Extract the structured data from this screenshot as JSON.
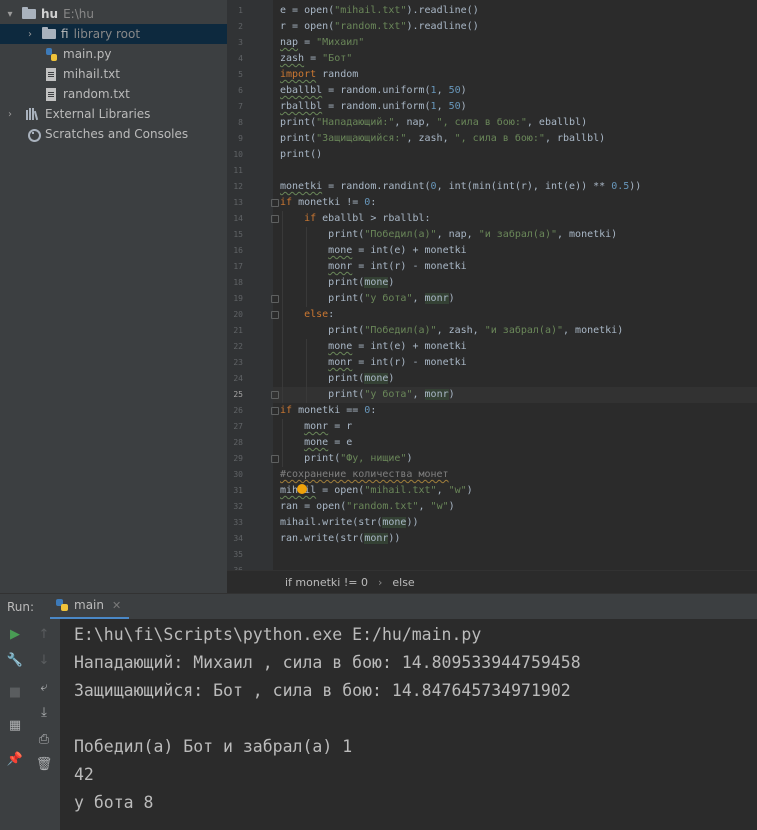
{
  "project_tree": {
    "root": {
      "name": "hu",
      "path": "E:\\hu"
    },
    "venv": {
      "name": "fi",
      "tag": "library root"
    },
    "files": [
      "main.py",
      "mihail.txt",
      "random.txt"
    ],
    "external": "External Libraries",
    "scratches": "Scratches and Consoles"
  },
  "editor": {
    "current_line": 25,
    "lines": [
      "e = open(\"mihail.txt\").readline()",
      "r = open(\"random.txt\").readline()",
      "nap = \"Михаил\"",
      "zash = \"Бот\"",
      "import random",
      "eballbl = random.uniform(1, 50)",
      "rballbl = random.uniform(1, 50)",
      "print(\"Нападающий:\", nap, \", сила в бою:\", eballbl)",
      "print(\"Защищающийся:\", zash, \", сила в бою:\", rballbl)",
      "print()",
      "",
      "monetki = random.randint(0, int(min(int(r), int(e)) ** 0.5))",
      "if monetki != 0:",
      "    if eballbl > rballbl:",
      "        print(\"Победил(а)\", nap, \"и забрал(а)\", monetki)",
      "        mone = int(e) + monetki",
      "        monr = int(r) - monetki",
      "        print(mone)",
      "        print(\"у бота\", monr)",
      "    else:",
      "        print(\"Победил(а)\", zash, \"и забрал(а)\", monetki)",
      "        mone = int(e) + monetki",
      "        monr = int(r) - monetki",
      "        print(mone)",
      "        print(\"у бота\", monr)",
      "if monetki == 0:",
      "    monr = r",
      "    mone = e",
      "    print(\"Фу, нищие\")",
      "#сохранение количества монет",
      "mihail = open(\"mihail.txt\", \"w\")",
      "ran = open(\"random.txt\", \"w\")",
      "mihail.write(str(mone))",
      "ran.write(str(monr))",
      "",
      ""
    ]
  },
  "breadcrumb": [
    "if monetki != 0",
    "else"
  ],
  "run_panel": {
    "label": "Run:",
    "tab": "main",
    "output": [
      "E:\\hu\\fi\\Scripts\\python.exe E:/hu/main.py",
      "Нападающий: Михаил , сила в бою: 14.809533944759458",
      "Защищающийся: Бот , сила в бою: 14.847645734971902",
      "",
      "Победил(а) Бот и забрал(а) 1",
      "42",
      "у бота 8"
    ]
  }
}
